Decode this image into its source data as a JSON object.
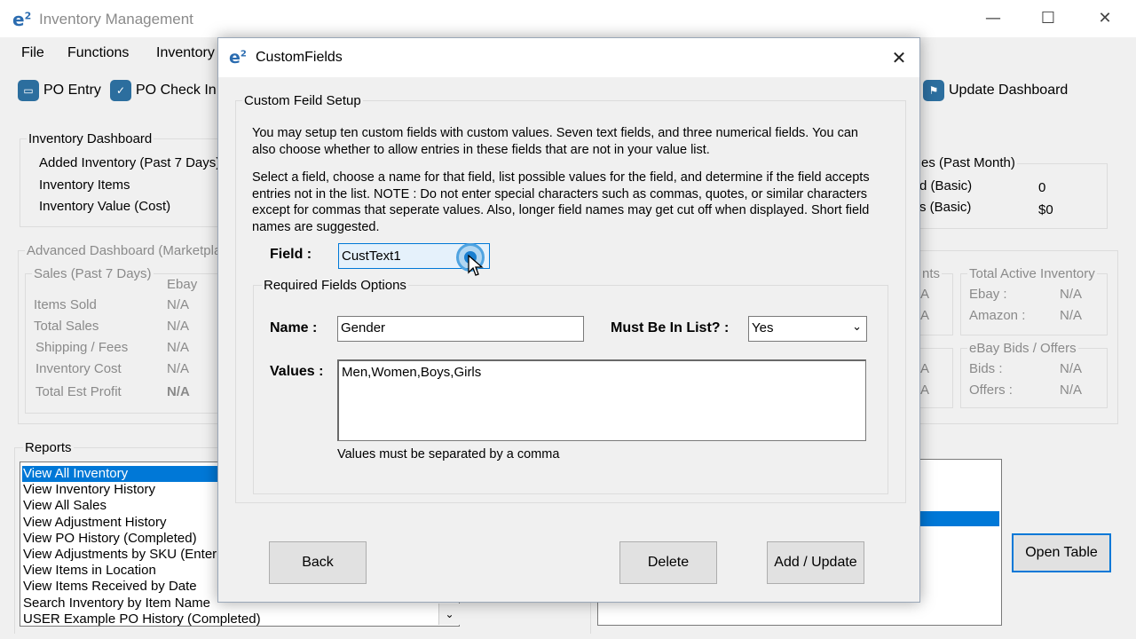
{
  "window": {
    "logo": "e",
    "logo_sup": "2",
    "title": "Inventory Management",
    "min_glyph": "—",
    "max_glyph": "☐",
    "close_glyph": "✕"
  },
  "menu": [
    "File",
    "Functions",
    "Inventory"
  ],
  "toolbar": {
    "po_entry": "PO Entry",
    "po_check_in": "PO Check In",
    "update_dashboard": "Update Dashboard"
  },
  "dashboard": {
    "title": "Inventory Dashboard",
    "rows": [
      "Added Inventory (Past 7 Days)",
      "Inventory Items",
      "Inventory Value (Cost)"
    ]
  },
  "sales_past_month": {
    "title": "es (Past Month)",
    "rows": [
      {
        "label": "d (Basic)",
        "value": "0"
      },
      {
        "label": "s (Basic)",
        "value": "$0"
      }
    ]
  },
  "advanced": {
    "title": "Advanced Dashboard (Marketpla",
    "sales_title": "Sales (Past 7 Days)",
    "col_ebay": "Ebay",
    "rows": [
      {
        "label": "Items Sold",
        "value": "N/A"
      },
      {
        "label": "Total Sales",
        "value": "N/A"
      },
      {
        "label": "Shipping / Fees",
        "value": "N/A"
      },
      {
        "label": "Inventory Cost",
        "value": "N/A"
      },
      {
        "label": "Total Est Profit",
        "value": "N/A"
      }
    ],
    "partial_title": "nts",
    "partial_values": [
      "A",
      "A",
      "A",
      "A"
    ],
    "total_active": {
      "title": "Total Active Inventory",
      "rows": [
        {
          "label": "Ebay :",
          "value": "N/A"
        },
        {
          "label": "Amazon :",
          "value": "N/A"
        }
      ]
    },
    "bids": {
      "title": "eBay Bids / Offers",
      "rows": [
        {
          "label": "Bids :",
          "value": "N/A"
        },
        {
          "label": "Offers :",
          "value": "N/A"
        }
      ]
    }
  },
  "reports": {
    "title": "Reports",
    "items": [
      "View All Inventory",
      "View Inventory History",
      "View All Sales",
      "View Adjustment History",
      "View PO History (Completed)",
      "View Adjustments by SKU (Enter",
      "View Items in Location",
      "View Items Received by Date",
      "Search Inventory by Item Name",
      "USER Example PO History (Completed)"
    ],
    "dropdown_glyph": "⌄"
  },
  "open_table": "Open Table",
  "dialog": {
    "logo": "e",
    "logo_sup": "2",
    "title": "CustomFields",
    "close_glyph": "✕",
    "group_title": "Custom Feild Setup",
    "para1": "You may setup ten custom fields with custom values. Seven text fields, and three numerical fields. You can also choose whether to allow entries in these fields that are not in your value list.",
    "para2": "Select a field, choose a name for that field, list possible values for the field, and determine if the field accepts entries not in the list. NOTE : Do not enter special characters such as commas, quotes, or similar characters except for commas that seperate values. Also, longer field names may get cut off when displayed. Short field names are suggested.",
    "field_label": "Field :",
    "field_value": "CustText1",
    "required_title": "Required Fields Options",
    "name_label": "Name :",
    "name_value": "Gender",
    "must_label": "Must Be In List? :",
    "must_value": "Yes",
    "must_arrow": "⌄",
    "values_label": "Values :",
    "values_value": "Men,Women,Boys,Girls",
    "values_hint": "Values must be separated by a comma",
    "back": "Back",
    "delete": "Delete",
    "add_update": "Add / Update"
  }
}
